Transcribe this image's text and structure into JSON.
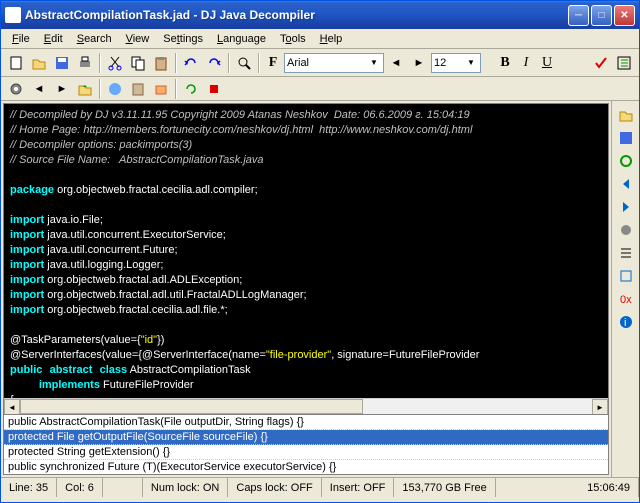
{
  "window": {
    "title": "AbstractCompilationTask.jad - DJ Java Decompiler"
  },
  "menu": {
    "file": "File",
    "edit": "Edit",
    "search": "Search",
    "view": "View",
    "settings": "Settings",
    "language": "Language",
    "tools": "Tools",
    "help": "Help"
  },
  "toolbar": {
    "font_label": "F",
    "font_name": "Arial",
    "font_size": "12",
    "bold": "B",
    "italic": "I",
    "underline": "U"
  },
  "code": {
    "c1": "// Decompiled by DJ v3.11.11.95 Copyright 2009 Atanas Neshkov  Date: 06.6.2009 г. 15:04:19",
    "c2": "// Home Page: http://members.fortunecity.com/neshkov/dj.html  http://www.neshkov.com/dj.html",
    "c3": "// Decompiler options: packimports(3) ",
    "c4": "// Source File Name:   AbstractCompilationTask.java",
    "kw_package": "package",
    "pkg": " org.objectweb.fractal.cecilia.adl.compiler;",
    "kw_import": "import",
    "imp1": " java.io.File;",
    "imp2": " java.util.concurrent.ExecutorService;",
    "imp3": " java.util.concurrent.Future;",
    "imp4": " java.util.logging.Logger;",
    "imp5": " org.objectweb.fractal.adl.ADLException;",
    "imp6": " org.objectweb.fractal.adl.util.FractalADLLogManager;",
    "imp7": " org.objectweb.fractal.cecilia.adl.file.*;",
    "ann1a": "@TaskParameters(value={",
    "ann1b": "\"id\"",
    "ann1c": "})",
    "ann2a": "@ServerInterfaces(value={@ServerInterface(name=",
    "ann2b": "\"file-provider\"",
    "ann2c": ", signature=FutureFileProvider",
    "kw_public": "public",
    "kw_abstract": "abstract",
    "kw_class": "class",
    "cls": " AbstractCompilationTask",
    "kw_implements": "implements",
    "ifc": " FutureFileProvider",
    "brace": "{"
  },
  "methods": {
    "m1": "public AbstractCompilationTask(File outputDir, String flags) {}",
    "m2": "protected File getOutputFile(SourceFile sourceFile) {}",
    "m3": "protected String getExtension() {}",
    "m4": "public synchronized Future (T)(ExecutorService executorService) {}"
  },
  "status": {
    "line": "Line:  35",
    "col": "Col:  6",
    "numlock": "Num lock:  ON",
    "capslock": "Caps lock:  OFF",
    "insert": "Insert:  OFF",
    "disk": "153,770 GB Free",
    "time": "15:06:49"
  }
}
